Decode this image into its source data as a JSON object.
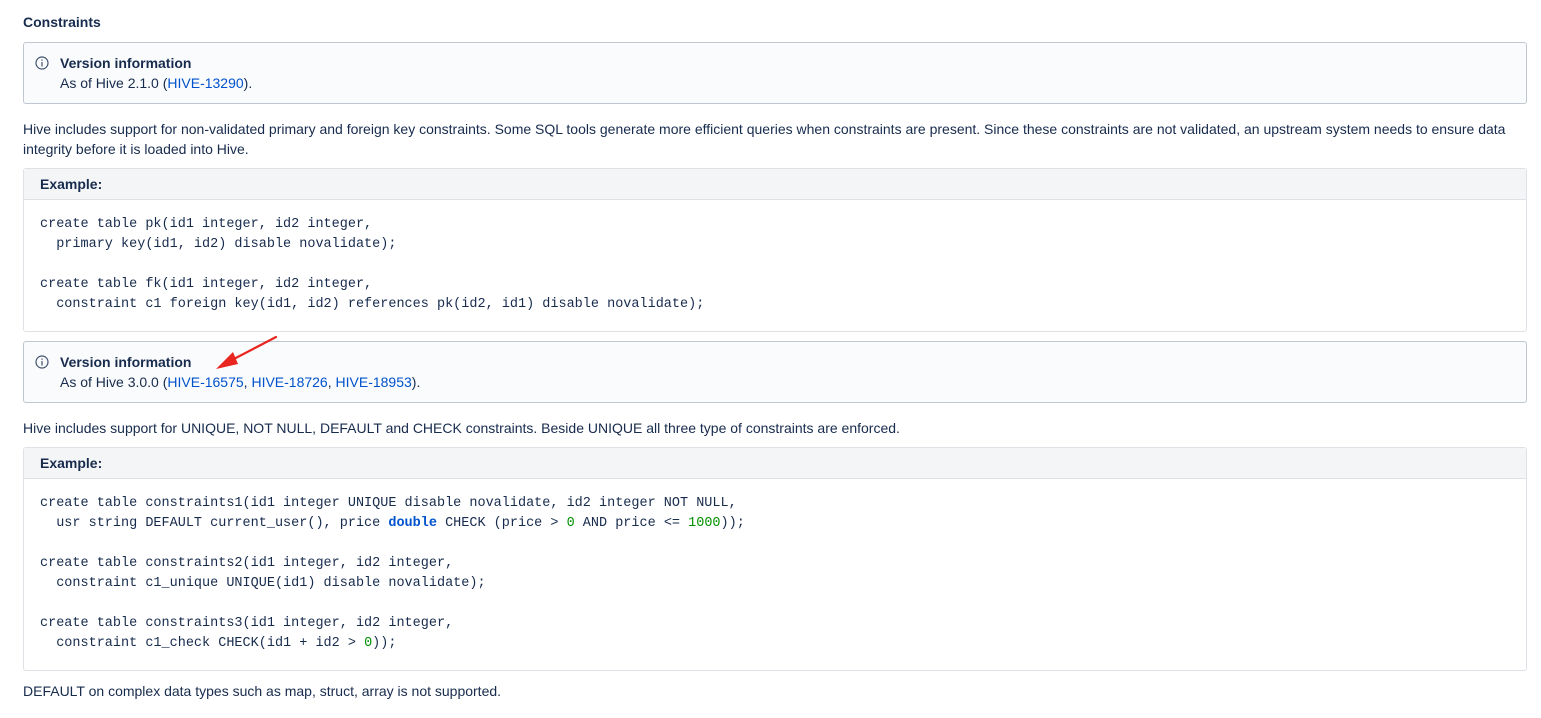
{
  "heading": "Constraints",
  "info1": {
    "title": "Version information",
    "prefix": "As of Hive 2.1.0 (",
    "links": [
      "HIVE-13290"
    ],
    "suffix": ")."
  },
  "para1": "Hive includes support for non-validated primary and foreign key constraints. Some SQL tools generate more efficient queries when constraints are present. Since these constraints are not validated, an upstream system needs to ensure data integrity before it is loaded into Hive.",
  "example1": {
    "header": "Example:",
    "lines": [
      "create table pk(id1 integer, id2 integer,",
      "  primary key(id1, id2) disable novalidate);",
      "",
      "create table fk(id1 integer, id2 integer,",
      "  constraint c1 foreign key(id1, id2) references pk(id2, id1) disable novalidate);"
    ]
  },
  "info2": {
    "title": "Version information",
    "prefix": "As of Hive 3.0.0 (",
    "links": [
      "HIVE-16575",
      "HIVE-18726",
      "HIVE-18953"
    ],
    "separator": ", ",
    "suffix": ")."
  },
  "para2": "Hive includes support for UNIQUE, NOT NULL, DEFAULT and CHECK constraints. Beside UNIQUE all three type of constraints are enforced.",
  "example2": {
    "header": "Example:",
    "lines": [
      {
        "parts": [
          "create table constraints1(id1 integer UNIQUE disable novalidate, id2 integer NOT NULL,"
        ]
      },
      {
        "parts": [
          "  usr string DEFAULT current_user(), price ",
          "double",
          " CHECK (price > ",
          "0",
          " AND price <= ",
          "1000",
          "));"
        ]
      },
      {
        "parts": [
          ""
        ]
      },
      {
        "parts": [
          "create table constraints2(id1 integer, id2 integer,"
        ]
      },
      {
        "parts": [
          "  constraint c1_unique UNIQUE(id1) disable novalidate);"
        ]
      },
      {
        "parts": [
          ""
        ]
      },
      {
        "parts": [
          "create table constraints3(id1 integer, id2 integer,"
        ]
      },
      {
        "parts": [
          "  constraint c1_check CHECK(id1 + id2 > ",
          "0",
          "));"
        ]
      }
    ]
  },
  "para3": "DEFAULT on complex data types such as map, struct, array is not supported.",
  "colors": {
    "link": "#0052cc",
    "keyword": "#0052cc",
    "number": "#009100",
    "annotation_arrow": "#e8251f"
  }
}
